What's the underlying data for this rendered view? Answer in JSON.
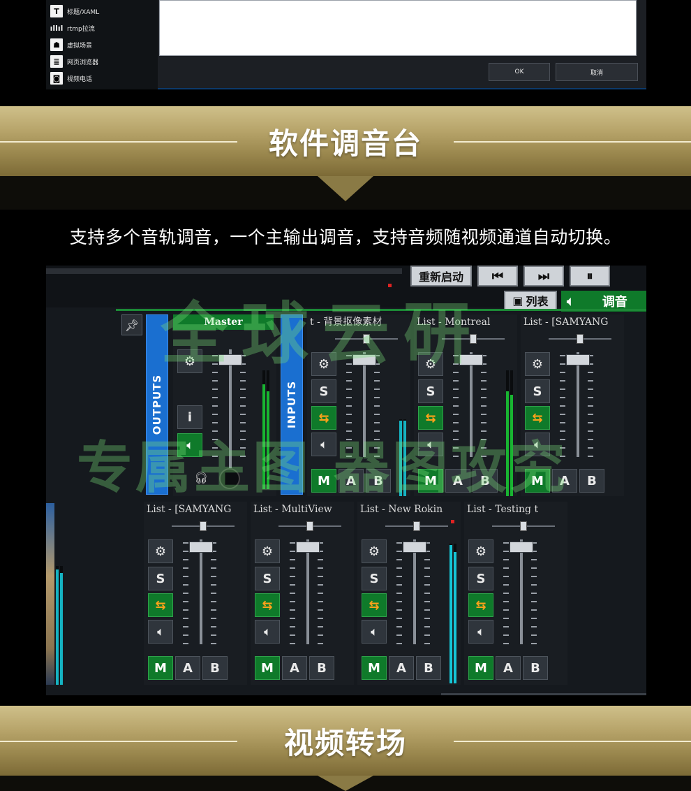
{
  "top_dialog": {
    "menu_items": [
      {
        "icon": "title-T-icon",
        "label": "标题/XAML"
      },
      {
        "icon": "rtmp-signal-icon",
        "label": "rtmp拉流"
      },
      {
        "icon": "person-icon",
        "label": "虚拟场景"
      },
      {
        "icon": "browser-list-icon",
        "label": "网页浏览器"
      },
      {
        "icon": "video-call-icon",
        "label": "视频电话"
      }
    ],
    "ok_label": "OK",
    "cancel_label": "取消"
  },
  "banner1": {
    "title": "软件调音台"
  },
  "caption": "支持多个音轨调音，一个主输出调音，支持音频随视频通道自动切换。",
  "mixer": {
    "toolbar": {
      "restart_label": "重新启动",
      "prev_icon": "skip-previous-icon",
      "next_icon": "skip-next-icon",
      "pause_icon": "pause-icon",
      "list_label": "列表",
      "tab_label": "调音"
    },
    "outputs_label": "OUTPUTS",
    "inputs_label": "INPUTS",
    "button_labels": {
      "solo": "S",
      "info": "i",
      "mute": "M",
      "a": "A",
      "b": "B"
    },
    "master": {
      "title": "Master"
    },
    "top_channels": [
      {
        "title": "t - 背景抠像素材"
      },
      {
        "title": "List - Montreal"
      },
      {
        "title": "List - [SAMYANG"
      }
    ],
    "bottom_channels": [
      {
        "title": "List - [SAMYANG"
      },
      {
        "title": "List - MultiView"
      },
      {
        "title": "List - New Rokin"
      },
      {
        "title": "List - Testing t"
      }
    ]
  },
  "watermark": {
    "line1": "全球云研",
    "line2": "专属主图 器图攻究"
  },
  "banner2": {
    "title": "视频转场"
  },
  "colors": {
    "gold": "#b7a46a",
    "mixer_green": "#0f7a2a",
    "strip_blue": "#1a6fd0",
    "orange_arrow": "#ffa21a"
  }
}
